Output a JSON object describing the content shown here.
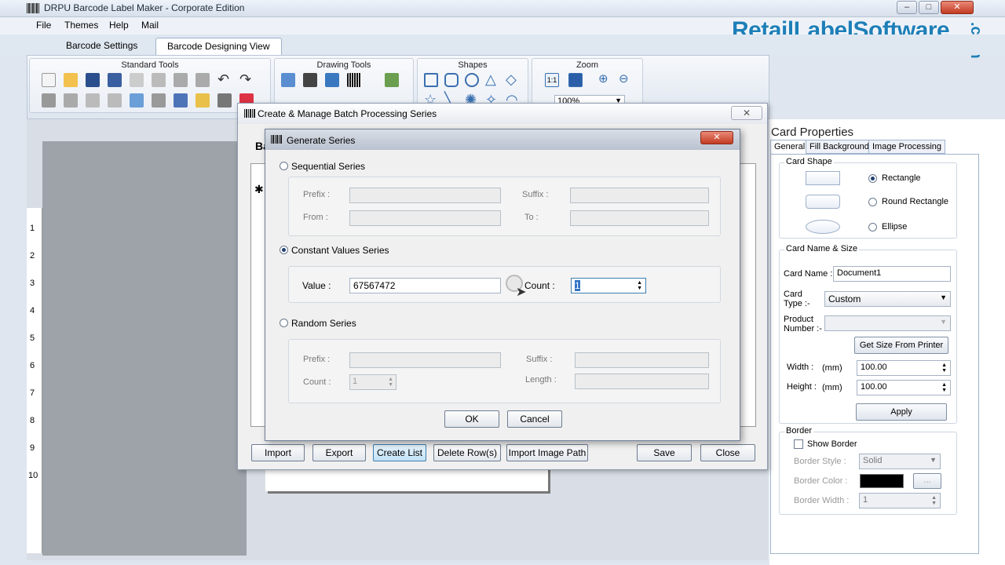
{
  "window": {
    "title": "DRPU Barcode Label Maker - Corporate Edition"
  },
  "menu": [
    "File",
    "Themes",
    "Help",
    "Mail"
  ],
  "tabs": [
    "Barcode Settings",
    "Barcode Designing View"
  ],
  "ribbon": {
    "groups": [
      "Standard Tools",
      "Drawing Tools",
      "Shapes",
      "Zoom"
    ],
    "zoom_value": "100%"
  },
  "brand": {
    "name": "RetailLabelSoftware",
    "suffix": ".com"
  },
  "ruler": [
    "1",
    "2",
    "3",
    "4",
    "5",
    "6",
    "7",
    "8",
    "9",
    "10"
  ],
  "card_properties": {
    "title": "Card Properties",
    "tabs": [
      "General",
      "Fill Background",
      "Image Processing"
    ],
    "card_shape": {
      "legend": "Card Shape",
      "options": [
        "Rectangle",
        "Round Rectangle",
        "Ellipse"
      ],
      "selected": "Rectangle"
    },
    "name_size": {
      "legend": "Card  Name & Size",
      "card_name_label": "Card Name :",
      "card_name": "Document1",
      "card_type_label": "Card\nType :-",
      "card_type": "Custom",
      "product_number_label": "Product\nNumber :-",
      "get_size_button": "Get Size From Printer",
      "width_label": "Width :",
      "height_label": "Height :",
      "unit": "(mm)",
      "width": "100.00",
      "height": "100.00",
      "apply_button": "Apply"
    },
    "border": {
      "legend": "Border",
      "show_border": "Show Border",
      "style_label": "Border Style :",
      "style": "Solid",
      "color_label": "Border Color :",
      "color": "#000000",
      "color_button": "...",
      "width_label": "Border Width :",
      "width": "1"
    }
  },
  "batch_dialog": {
    "title": "Create & Manage Batch Processing Series",
    "heading": "Ba",
    "buttons": [
      "Import",
      "Export",
      "Create List",
      "Delete Row(s)",
      "Import Image Path",
      "Save",
      "Close"
    ]
  },
  "generate_dialog": {
    "title": "Generate Series",
    "sequential": {
      "label": "Sequential Series",
      "prefix": "Prefix :",
      "suffix": "Suffix :",
      "from": "From :",
      "to": "To :"
    },
    "constant": {
      "label": "Constant Values Series",
      "value_label": "Value :",
      "value": "67567472",
      "count_label": "Count :",
      "count": "1"
    },
    "random": {
      "label": "Random Series",
      "prefix": "Prefix :",
      "suffix": "Suffix :",
      "count_label": "Count :",
      "count": "1",
      "length": "Length :"
    },
    "ok": "OK",
    "cancel": "Cancel"
  },
  "colors": {
    "brand": "#1e7fb8",
    "accent": "#1f3f70"
  }
}
